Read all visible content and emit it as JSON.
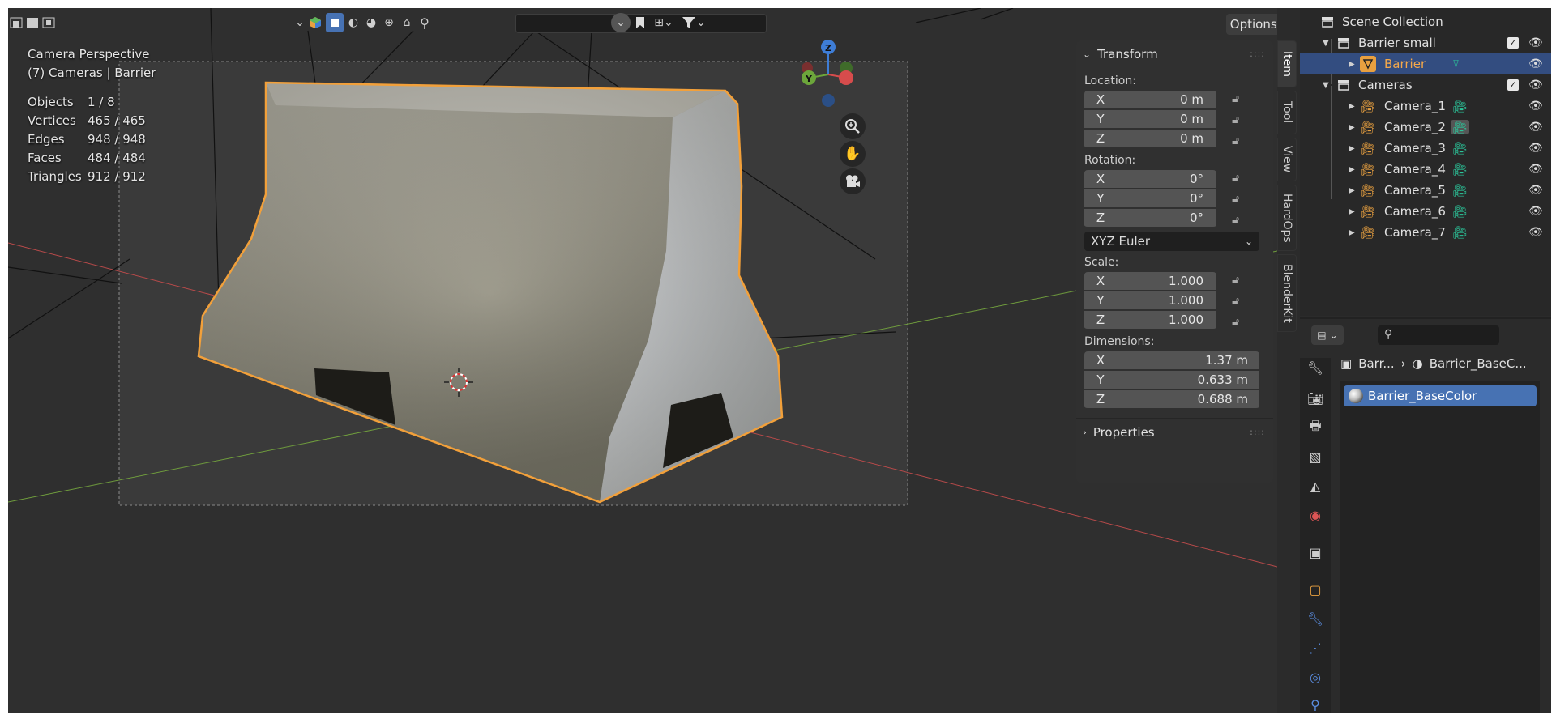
{
  "viewport": {
    "overlay_title": "Camera Perspective",
    "overlay_subtitle": "(7) Cameras | Barrier",
    "stats": [
      {
        "label": "Objects",
        "value": "1 / 8"
      },
      {
        "label": "Vertices",
        "value": "465 / 465"
      },
      {
        "label": "Edges",
        "value": "948 / 948"
      },
      {
        "label": "Faces",
        "value": "484 / 484"
      },
      {
        "label": "Triangles",
        "value": "912 / 912"
      }
    ],
    "options_label": "Options",
    "gizmo": {
      "z": "Z",
      "y": "Y"
    }
  },
  "npanel": {
    "transform_title": "Transform",
    "location_label": "Location:",
    "location": [
      {
        "axis": "X",
        "value": "0 m"
      },
      {
        "axis": "Y",
        "value": "0 m"
      },
      {
        "axis": "Z",
        "value": "0 m"
      }
    ],
    "rotation_label": "Rotation:",
    "rotation": [
      {
        "axis": "X",
        "value": "0°"
      },
      {
        "axis": "Y",
        "value": "0°"
      },
      {
        "axis": "Z",
        "value": "0°"
      }
    ],
    "rotation_mode": "XYZ Euler",
    "scale_label": "Scale:",
    "scale": [
      {
        "axis": "X",
        "value": "1.000"
      },
      {
        "axis": "Y",
        "value": "1.000"
      },
      {
        "axis": "Z",
        "value": "1.000"
      }
    ],
    "dimensions_label": "Dimensions:",
    "dimensions": [
      {
        "axis": "X",
        "value": "1.37 m"
      },
      {
        "axis": "Y",
        "value": "0.633 m"
      },
      {
        "axis": "Z",
        "value": "0.688 m"
      }
    ],
    "properties_title": "Properties"
  },
  "vtabs": [
    "Item",
    "Tool",
    "View",
    "HardOps",
    "BlenderKit"
  ],
  "outliner": {
    "scene_collection": "Scene Collection",
    "barrier_collection": "Barrier small",
    "barrier_object": "Barrier",
    "cameras_collection": "Cameras",
    "cameras": [
      "Camera_1",
      "Camera_2",
      "Camera_3",
      "Camera_4",
      "Camera_5",
      "Camera_6",
      "Camera_7"
    ]
  },
  "properties": {
    "breadcrumb_object": "Barr...",
    "breadcrumb_material": "Barrier_BaseC...",
    "material_slot": "Barrier_BaseColor"
  },
  "colors": {
    "selection_outline": "#f2a03a",
    "active_row": "#334d80",
    "material_slot": "#4772b3",
    "camera_data_icon": "#2bc59a",
    "camera_object_icon": "#e8a040"
  }
}
